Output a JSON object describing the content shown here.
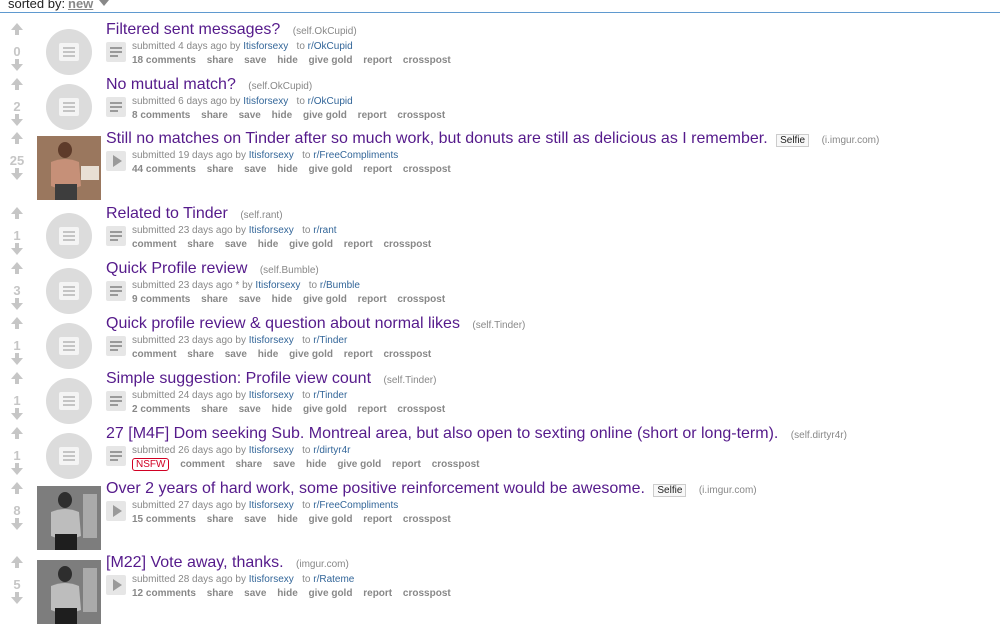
{
  "sort": {
    "label": "sorted by:",
    "value": "new"
  },
  "posts": [
    {
      "score": "0",
      "title": "Filtered sent messages?",
      "domain": "(self.OkCupid)",
      "flair": "",
      "thumb": "self",
      "submitted": "submitted 4 days ago by",
      "author": "Itisforsexy",
      "to": "to",
      "subreddit": "r/OkCupid",
      "nsfw": "",
      "comments": "18 comments"
    },
    {
      "score": "2",
      "title": "No mutual match?",
      "domain": "(self.OkCupid)",
      "flair": "",
      "thumb": "self",
      "submitted": "submitted 6 days ago by",
      "author": "Itisforsexy",
      "to": "to",
      "subreddit": "r/OkCupid",
      "nsfw": "",
      "comments": "8 comments"
    },
    {
      "score": "25",
      "title": "Still no matches on Tinder after so much work, but donuts are still as delicious as I remember.",
      "domain": "(i.imgur.com)",
      "flair": "Selfie",
      "thumb": "photo",
      "submitted": "submitted 19 days ago by",
      "author": "Itisforsexy",
      "to": "to",
      "subreddit": "r/FreeCompliments",
      "nsfw": "",
      "comments": "44 comments"
    },
    {
      "score": "1",
      "title": "Related to Tinder",
      "domain": "(self.rant)",
      "flair": "",
      "thumb": "self",
      "submitted": "submitted 23 days ago by",
      "author": "Itisforsexy",
      "to": "to",
      "subreddit": "r/rant",
      "nsfw": "",
      "comments": "comment"
    },
    {
      "score": "3",
      "title": "Quick Profile review",
      "domain": "(self.Bumble)",
      "flair": "",
      "thumb": "self",
      "submitted": "submitted 23 days ago * by",
      "author": "Itisforsexy",
      "to": "to",
      "subreddit": "r/Bumble",
      "nsfw": "",
      "comments": "9 comments"
    },
    {
      "score": "1",
      "title": "Quick profile review & question about normal likes",
      "domain": "(self.Tinder)",
      "flair": "",
      "thumb": "self",
      "submitted": "submitted 23 days ago by",
      "author": "Itisforsexy",
      "to": "to",
      "subreddit": "r/Tinder",
      "nsfw": "",
      "comments": "comment"
    },
    {
      "score": "1",
      "title": "Simple suggestion: Profile view count",
      "domain": "(self.Tinder)",
      "flair": "",
      "thumb": "self",
      "submitted": "submitted 24 days ago by",
      "author": "Itisforsexy",
      "to": "to",
      "subreddit": "r/Tinder",
      "nsfw": "",
      "comments": "2 comments"
    },
    {
      "score": "1",
      "title": "27 [M4F] Dom seeking Sub. Montreal area, but also open to sexting online (short or long-term).",
      "domain": "(self.dirtyr4r)",
      "flair": "",
      "thumb": "self",
      "submitted": "submitted 26 days ago by",
      "author": "Itisforsexy",
      "to": "to",
      "subreddit": "r/dirtyr4r",
      "nsfw": "NSFW",
      "comments": "comment"
    },
    {
      "score": "8",
      "title": "Over 2 years of hard work, some positive reinforcement would be awesome.",
      "domain": "(i.imgur.com)",
      "flair": "Selfie",
      "thumb": "photo",
      "submitted": "submitted 27 days ago by",
      "author": "Itisforsexy",
      "to": "to",
      "subreddit": "r/FreeCompliments",
      "nsfw": "",
      "comments": "15 comments"
    },
    {
      "score": "5",
      "title": "[M22] Vote away, thanks.",
      "domain": "(imgur.com)",
      "flair": "",
      "thumb": "photo",
      "submitted": "submitted 28 days ago by",
      "author": "Itisforsexy",
      "to": "to",
      "subreddit": "r/Rateme",
      "nsfw": "",
      "comments": "12 comments"
    }
  ],
  "actions": {
    "share": "share",
    "save": "save",
    "hide": "hide",
    "gold": "give gold",
    "report": "report",
    "crosspost": "crosspost"
  },
  "icons": {
    "upvote": "upvote-arrow-icon",
    "downvote": "downvote-arrow-icon",
    "self": "self-post-icon",
    "expand_text": "text-expando-icon",
    "expand_play": "play-expando-icon"
  },
  "colors": {
    "title": "#551a8b",
    "link": "#336699",
    "nsfw": "#d10023",
    "meta": "#888888"
  }
}
